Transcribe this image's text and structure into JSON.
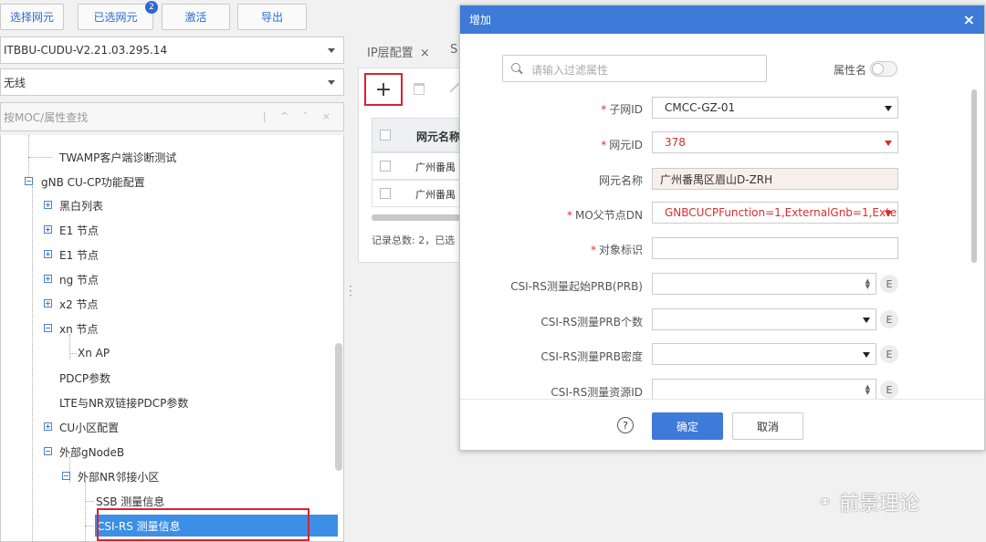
{
  "toolbar": {
    "select_ne": "选择网元",
    "selected_ne": "已选网元",
    "selected_count": "2",
    "activate": "激活",
    "export": "导出"
  },
  "left": {
    "version_select": "ITBBU-CUDU-V2.21.03.295.14",
    "radio_select": "无线",
    "search_placeholder": "按MOC/属性查找",
    "tree": [
      "TWAMP客户端诊断测试",
      "gNB CU-CP功能配置",
      "黑白列表",
      "E1 节点",
      "E1 节点",
      "ng 节点",
      "x2 节点",
      "xn 节点",
      "Xn AP",
      "PDCP参数",
      "LTE与NR双链接PDCP参数",
      "CU小区配置",
      "外部gNodeB",
      "外部NR邻接小区",
      "SSB 测量信息",
      "CSI-RS 测量信息"
    ]
  },
  "middle": {
    "tab_ip": "IP层配置",
    "tab_close": "×",
    "tab_s": "S",
    "add_icon": "+",
    "col_name": "网元名称",
    "row1": "广州番禺",
    "row2": "广州番禺",
    "footer": "记录总数: 2，已选"
  },
  "dialog": {
    "title": "增加",
    "close": "×",
    "filter_placeholder": "请输入过滤属性",
    "attr_toggle_label": "属性名",
    "fields": {
      "subnet_label": "子网ID",
      "subnet_value": "CMCC-GZ-01",
      "ne_label": "网元ID",
      "ne_value": "378",
      "ne_name_label": "网元名称",
      "ne_name_value": "广州番禺区眉山D-ZRH",
      "mo_label": "MO父节点DN",
      "mo_value": "GNBCUCPFunction=1,ExternalGnb=1,Exte",
      "obj_label": "对象标识",
      "obj_value": "",
      "csi1_label": "CSI-RS测量起始PRB(PRB)",
      "csi2_label": "CSI-RS测量PRB个数",
      "csi3_label": "CSI-RS测量PRB密度",
      "csi4_label": "CSI-RS测量资源ID",
      "e_btn": "E"
    },
    "help": "?",
    "ok": "确定",
    "cancel": "取消"
  },
  "watermark": "前景理论",
  "colors": {
    "accent": "#3e7ad7",
    "required": "#e0302f",
    "highlight_box": "#d9232d",
    "tree_selected": "#3b8fe6"
  }
}
